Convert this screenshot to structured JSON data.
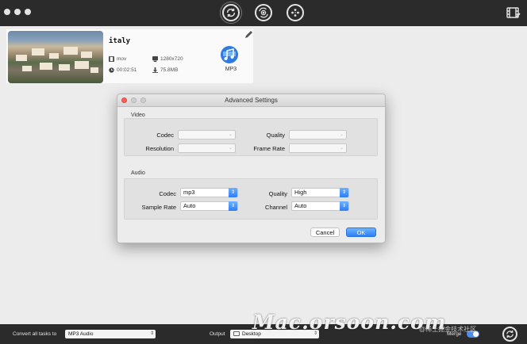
{
  "toolbar": {
    "icons": [
      "convert-icon",
      "dvd-convert-icon",
      "film-reel-icon",
      "video-edit-icon"
    ]
  },
  "task": {
    "name": "italy",
    "format": "mov",
    "resolution": "1280x720",
    "duration": "00:02:51",
    "size": "75.8MB",
    "target_format": "MP3"
  },
  "dialog": {
    "title": "Advanced Settings",
    "video": {
      "group_label": "Video",
      "codec_label": "Codec",
      "codec_value": "",
      "quality_label": "Quality",
      "quality_value": "",
      "resolution_label": "Resolution",
      "resolution_value": "",
      "framerate_label": "Frame Rate",
      "framerate_value": ""
    },
    "audio": {
      "group_label": "Audio",
      "codec_label": "Codec",
      "codec_value": "mp3",
      "quality_label": "Quality",
      "quality_value": "High",
      "samplerate_label": "Sample Rate",
      "samplerate_value": "Auto",
      "channel_label": "Channel",
      "channel_value": "Auto"
    },
    "cancel_label": "Cancel",
    "ok_label": "OK"
  },
  "bottom": {
    "convert_all_label": "Convert all tasks to",
    "convert_all_value": "MP3 Audio",
    "output_label": "Output",
    "output_value": "Desktop",
    "merge_label": "Merge"
  },
  "watermark": {
    "main": "Mac.orsoon.com",
    "sub": "@稀土掘金技术社区"
  },
  "colors": {
    "topbar": "#2b2b2b",
    "accent_blue": "#2d7df6",
    "close_red": "#fc5f57"
  }
}
